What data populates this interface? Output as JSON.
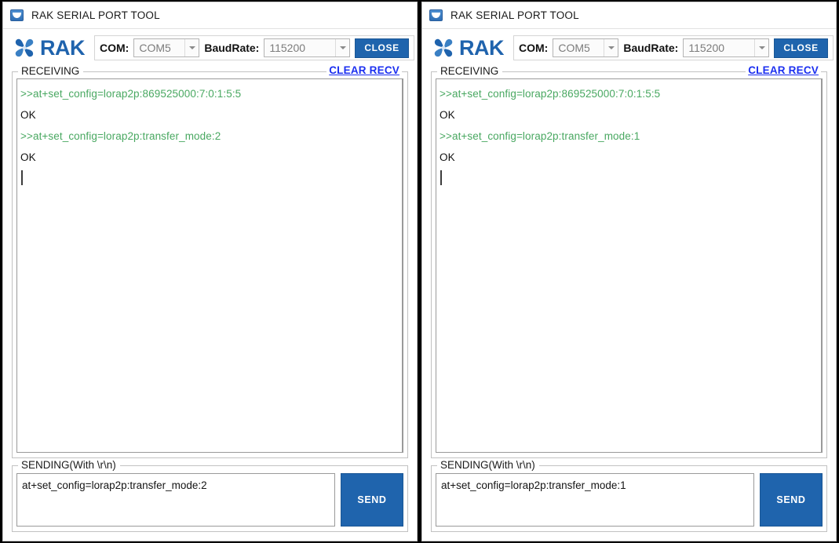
{
  "app": {
    "title": "RAK SERIAL PORT TOOL",
    "logo_text": "RAK",
    "accent_color": "#1f64ad",
    "link_color": "#1b2ff0",
    "command_text_color": "#49a861"
  },
  "toolbar": {
    "com_label": "COM:",
    "com_value": "COM5",
    "baud_label": "BaudRate:",
    "baud_value": "115200",
    "close_label": "CLOSE"
  },
  "receiving": {
    "group_label": "RECEIVING",
    "clear_label": "CLEAR RECV"
  },
  "sending": {
    "group_label": "SENDING(With \\r\\n)",
    "send_label": "SEND"
  },
  "panels": [
    {
      "title": "RAK SERIAL PORT TOOL",
      "receive_lines": [
        {
          "kind": "cmd",
          "text": ">>at+set_config=lorap2p:869525000:7:0:1:5:5"
        },
        {
          "kind": "resp",
          "text": "OK"
        },
        {
          "kind": "cmd",
          "text": ">>at+set_config=lorap2p:transfer_mode:2"
        },
        {
          "kind": "resp",
          "text": "OK"
        }
      ],
      "send_value": "at+set_config=lorap2p:transfer_mode:2"
    },
    {
      "title": "RAK SERIAL PORT TOOL",
      "receive_lines": [
        {
          "kind": "cmd",
          "text": ">>at+set_config=lorap2p:869525000:7:0:1:5:5"
        },
        {
          "kind": "resp",
          "text": "OK"
        },
        {
          "kind": "cmd",
          "text": ">>at+set_config=lorap2p:transfer_mode:1"
        },
        {
          "kind": "resp",
          "text": "OK"
        }
      ],
      "send_value": "at+set_config=lorap2p:transfer_mode:1"
    }
  ]
}
